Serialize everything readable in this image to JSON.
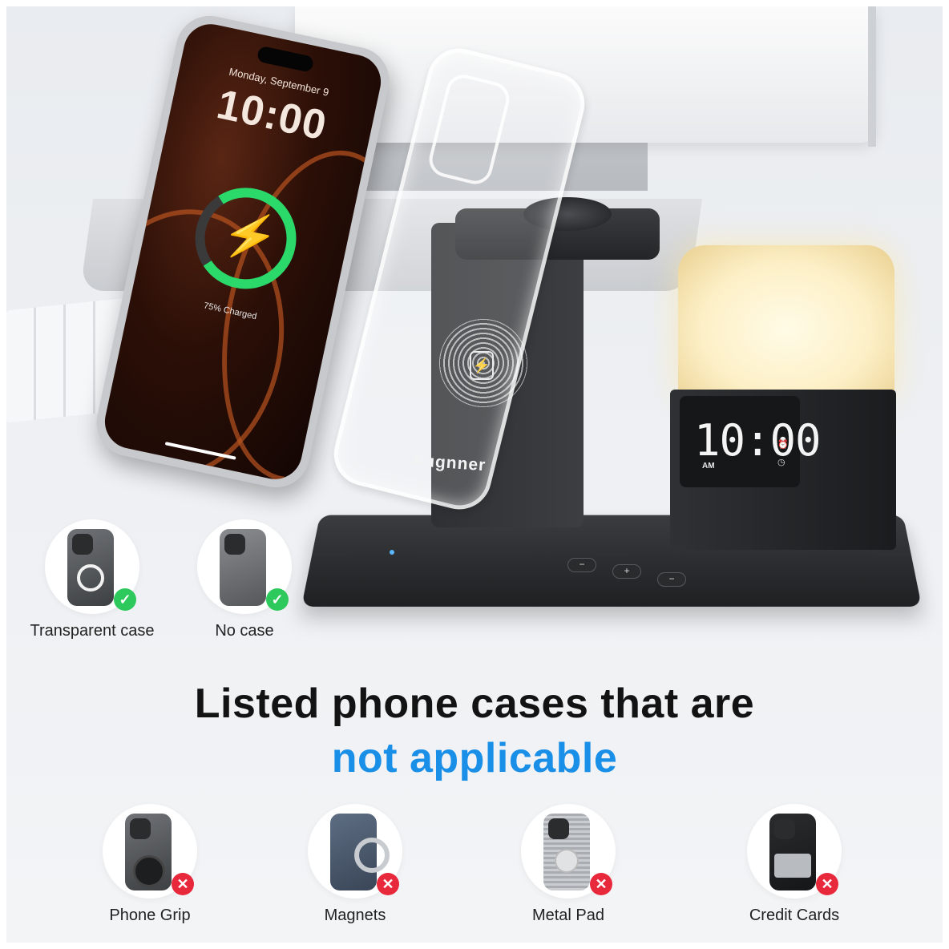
{
  "phone_screen": {
    "date": "Monday, September 9",
    "time": "10:00",
    "charge_status": "75% Charged",
    "charge_level": 0.75
  },
  "charger": {
    "brand": "Augnner",
    "clock_time": "10:00",
    "clock_period": "AM",
    "buttons": [
      "−",
      "+",
      "−"
    ]
  },
  "compatible": [
    {
      "label": "Transparent case",
      "status": "ok"
    },
    {
      "label": "No case",
      "status": "ok"
    }
  ],
  "headline": {
    "line1": "Listed phone cases that are",
    "line2": "not applicable",
    "accent_color": "#1a8fe8"
  },
  "not_applicable": [
    {
      "label": "Phone Grip",
      "status": "no"
    },
    {
      "label": "Magnets",
      "status": "no"
    },
    {
      "label": "Metal Pad",
      "status": "no"
    },
    {
      "label": "Credit Cards",
      "status": "no"
    }
  ],
  "icons": {
    "ok": "check-icon",
    "no": "x-icon",
    "bolt": "lightning-bolt-icon"
  },
  "colors": {
    "ok_badge": "#2ec95c",
    "no_badge": "#e8283b",
    "charge_ring": "#2bd96a"
  }
}
